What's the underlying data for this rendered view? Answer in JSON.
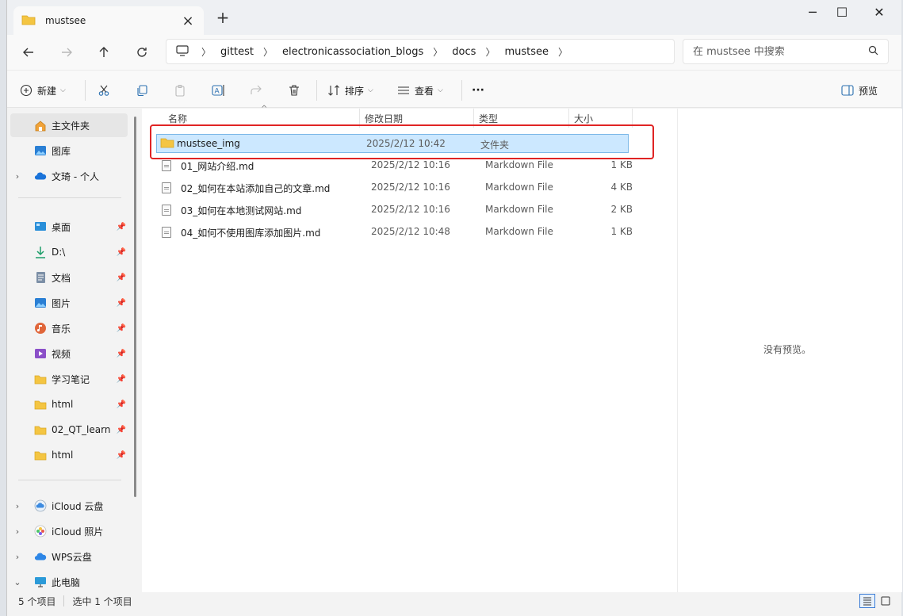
{
  "window": {
    "tab_title": "mustsee",
    "minimize": "─",
    "maximize": "☐",
    "close": "✕"
  },
  "address": {
    "crumbs": [
      "gittest",
      "electronicassociation_blogs",
      "docs",
      "mustsee"
    ],
    "search_placeholder": "在 mustsee 中搜索"
  },
  "toolbar": {
    "new_label": "新建",
    "sort_label": "排序",
    "view_label": "查看",
    "more_label": "···",
    "preview_label": "预览"
  },
  "sidebar": {
    "top": [
      {
        "label": "主文件夹",
        "icon": "home-icon",
        "active": true
      },
      {
        "label": "图库",
        "icon": "gallery-icon"
      },
      {
        "label": "文琦 - 个人",
        "icon": "onedrive-icon"
      }
    ],
    "pinned": [
      {
        "label": "桌面",
        "icon": "desktop-icon"
      },
      {
        "label": "D:\\",
        "icon": "download-icon"
      },
      {
        "label": "文档",
        "icon": "documents-icon"
      },
      {
        "label": "图片",
        "icon": "pictures-icon"
      },
      {
        "label": "音乐",
        "icon": "music-icon"
      },
      {
        "label": "视频",
        "icon": "video-icon"
      },
      {
        "label": "学习笔记",
        "icon": "folder-icon"
      },
      {
        "label": "html",
        "icon": "folder-icon"
      },
      {
        "label": "02_QT_learn",
        "icon": "folder-icon"
      },
      {
        "label": "html",
        "icon": "folder-icon"
      }
    ],
    "bottom": [
      {
        "label": "iCloud 云盘",
        "icon": "icloud-icon"
      },
      {
        "label": "iCloud 照片",
        "icon": "icloud-photos-icon"
      },
      {
        "label": "WPS云盘",
        "icon": "wps-cloud-icon"
      },
      {
        "label": "此电脑",
        "icon": "this-pc-icon"
      }
    ]
  },
  "columns": {
    "name": "名称",
    "date": "修改日期",
    "type": "类型",
    "size": "大小"
  },
  "files": [
    {
      "name": "mustsee_img",
      "date": "2025/2/12 10:42",
      "type": "文件夹",
      "size": "",
      "kind": "folder",
      "selected": true
    },
    {
      "name": "01_网站介绍.md",
      "date": "2025/2/12 10:16",
      "type": "Markdown File",
      "size": "1 KB",
      "kind": "file"
    },
    {
      "name": "02_如何在本站添加自己的文章.md",
      "date": "2025/2/12 10:16",
      "type": "Markdown File",
      "size": "4 KB",
      "kind": "file"
    },
    {
      "name": "03_如何在本地测试网站.md",
      "date": "2025/2/12 10:16",
      "type": "Markdown File",
      "size": "2 KB",
      "kind": "file"
    },
    {
      "name": "04_如何不使用图库添加图片.md",
      "date": "2025/2/12 10:48",
      "type": "Markdown File",
      "size": "1 KB",
      "kind": "file"
    }
  ],
  "preview": {
    "empty_text": "没有预览。"
  },
  "status": {
    "item_count": "5 个项目",
    "selected_count": "选中 1 个项目"
  },
  "colors": {
    "folder": "#f4c542",
    "selection": "#cce8ff",
    "highlight_box": "#e02424",
    "accent": "#0067c0"
  }
}
